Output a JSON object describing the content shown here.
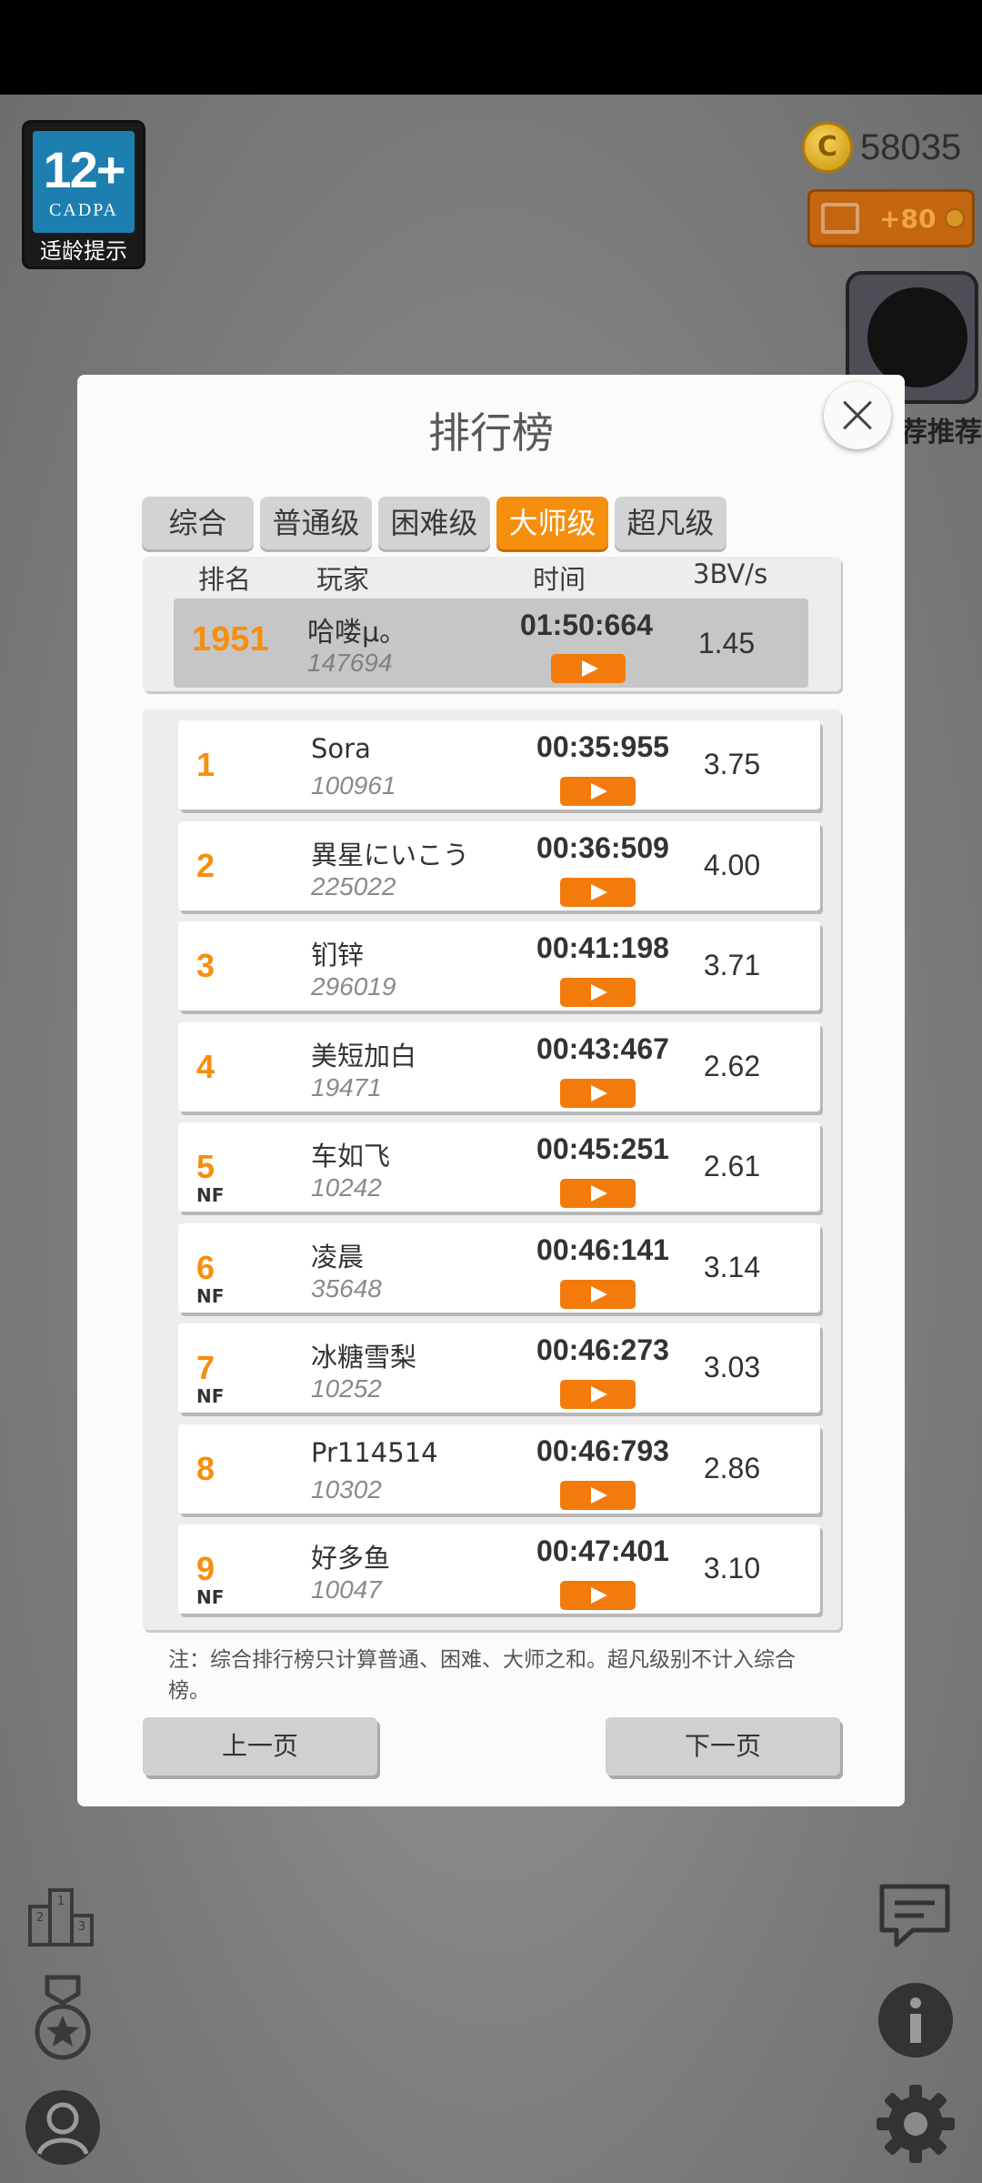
{
  "background": {
    "age_badge": {
      "age": "12+",
      "org": "CADPA",
      "caption": "适龄提示"
    },
    "coins": {
      "icon": "coin-icon",
      "coin_letter": "C",
      "count": "58035"
    },
    "video_bonus": {
      "icon": "film-icon",
      "amount": "+80"
    },
    "recommend_label": "荐推荐",
    "left_icons": [
      "podium-icon",
      "medal-icon",
      "profile-icon"
    ],
    "right_icons": [
      "chat-icon",
      "info-icon",
      "gear-icon"
    ]
  },
  "dialog": {
    "title": "排行榜",
    "close_icon": "close-icon",
    "tabs": [
      {
        "label": "综合",
        "active": false
      },
      {
        "label": "普通级",
        "active": false
      },
      {
        "label": "困难级",
        "active": false
      },
      {
        "label": "大师级",
        "active": true
      },
      {
        "label": "超凡级",
        "active": false
      }
    ],
    "columns": {
      "rank": "排名",
      "player": "玩家",
      "time": "时间",
      "bvs": "3BV/s"
    },
    "my_entry": {
      "rank": "1951",
      "name": "哈喽μ。",
      "id": "147694",
      "time": "01:50:664",
      "bvs": "1.45"
    },
    "rows": [
      {
        "rank": "1",
        "nf": "",
        "name": "Sora",
        "id": "100961",
        "time": "00:35:955",
        "bvs": "3.75"
      },
      {
        "rank": "2",
        "nf": "",
        "name": "異星にいこう",
        "id": "225022",
        "time": "00:36:509",
        "bvs": "4.00"
      },
      {
        "rank": "3",
        "nf": "",
        "name": "钔锌",
        "id": "296019",
        "time": "00:41:198",
        "bvs": "3.71"
      },
      {
        "rank": "4",
        "nf": "",
        "name": "美短加白",
        "id": "19471",
        "time": "00:43:467",
        "bvs": "2.62"
      },
      {
        "rank": "5",
        "nf": "NF",
        "name": "车如飞",
        "id": "10242",
        "time": "00:45:251",
        "bvs": "2.61"
      },
      {
        "rank": "6",
        "nf": "NF",
        "name": "凌晨",
        "id": "35648",
        "time": "00:46:141",
        "bvs": "3.14"
      },
      {
        "rank": "7",
        "nf": "NF",
        "name": "冰糖雪梨",
        "id": "10252",
        "time": "00:46:273",
        "bvs": "3.03"
      },
      {
        "rank": "8",
        "nf": "",
        "name": "Pr114514",
        "id": "10302",
        "time": "00:46:793",
        "bvs": "2.86"
      },
      {
        "rank": "9",
        "nf": "NF",
        "name": "好多鱼",
        "id": "10047",
        "time": "00:47:401",
        "bvs": "3.10"
      }
    ],
    "note": "注：综合排行榜只计算普通、困难、大师之和。超凡级别不计入综合榜。",
    "prev_label": "上一页",
    "next_label": "下一页"
  },
  "colors": {
    "accent": "#f68f0e",
    "play_button": "#f27b0c",
    "tab_inactive": "#d3d3d3"
  }
}
